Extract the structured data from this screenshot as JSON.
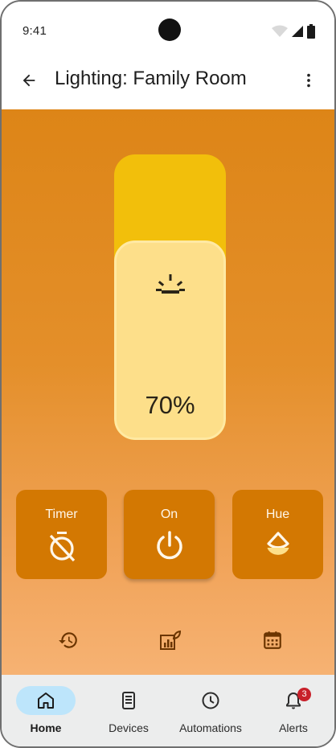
{
  "status_bar": {
    "time": "9:41",
    "icons": [
      "wifi-icon",
      "signal-icon",
      "battery-icon"
    ]
  },
  "app_bar": {
    "title": "Lighting: Family Room",
    "back_icon": "arrow-back-icon",
    "menu_icon": "more-vert-icon"
  },
  "brightness": {
    "level_label": "70%",
    "level": 0.7,
    "icon": "light-bulb-icon"
  },
  "controls": {
    "timer": {
      "label": "Timer",
      "icon": "timer-off-icon"
    },
    "power": {
      "label": "On",
      "icon": "power-icon"
    },
    "hue": {
      "label": "Hue",
      "icon": "hue-drop-icon"
    }
  },
  "shortcuts": [
    "history-icon",
    "energy-icon",
    "calendar-icon"
  ],
  "bottom_nav": {
    "items": [
      {
        "label": "Home",
        "icon": "home-icon",
        "active": true
      },
      {
        "label": "Devices",
        "icon": "devices-icon"
      },
      {
        "label": "Automations",
        "icon": "clock-icon"
      },
      {
        "label": "Alerts",
        "icon": "bell-icon",
        "badge": "3"
      }
    ]
  },
  "colors": {
    "accent": "#d37802",
    "background_top": "#dd8517",
    "background_bottom": "#f6b273",
    "slider_track": "#f2bf0b",
    "slider_fill": "#fddf8a",
    "nav_active_pill": "#bde5fb",
    "badge": "#c8202a"
  }
}
